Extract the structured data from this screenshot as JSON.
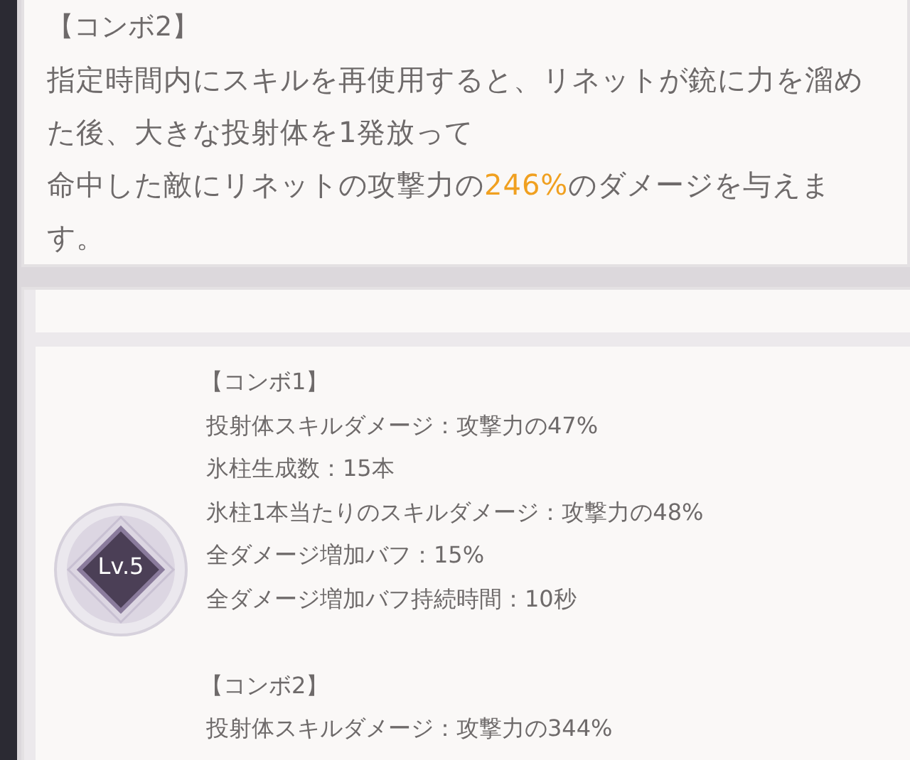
{
  "top_panel": {
    "heading": "【コンボ2】",
    "paragraphs": [
      {
        "segments": [
          {
            "text": "指定時間内にスキルを再使用すると、リネットが銃に力を溜めた後、大きな投射体を1発放って",
            "highlight": false
          }
        ]
      },
      {
        "segments": [
          {
            "text": "命中した敵にリネットの攻撃力の",
            "highlight": false
          },
          {
            "text": "246%",
            "highlight": true
          },
          {
            "text": "のダメージを与えます。",
            "highlight": false
          }
        ]
      }
    ]
  },
  "level_card": {
    "badge": "Lv.5",
    "lines": [
      {
        "kind": "heading",
        "text": "【コンボ1】"
      },
      {
        "kind": "stat",
        "text": "投射体スキルダメージ：攻撃力の47%"
      },
      {
        "kind": "stat",
        "text": "氷柱生成数：15本"
      },
      {
        "kind": "stat",
        "text": "氷柱1本当たりのスキルダメージ：攻撃力の48%"
      },
      {
        "kind": "stat",
        "text": "全ダメージ増加バフ：15%"
      },
      {
        "kind": "stat",
        "text": "全ダメージ増加バフ持続時間：10秒"
      },
      {
        "kind": "spacer"
      },
      {
        "kind": "heading",
        "text": "【コンボ2】"
      },
      {
        "kind": "stat",
        "text": "投射体スキルダメージ：攻撃力の344%"
      }
    ]
  }
}
